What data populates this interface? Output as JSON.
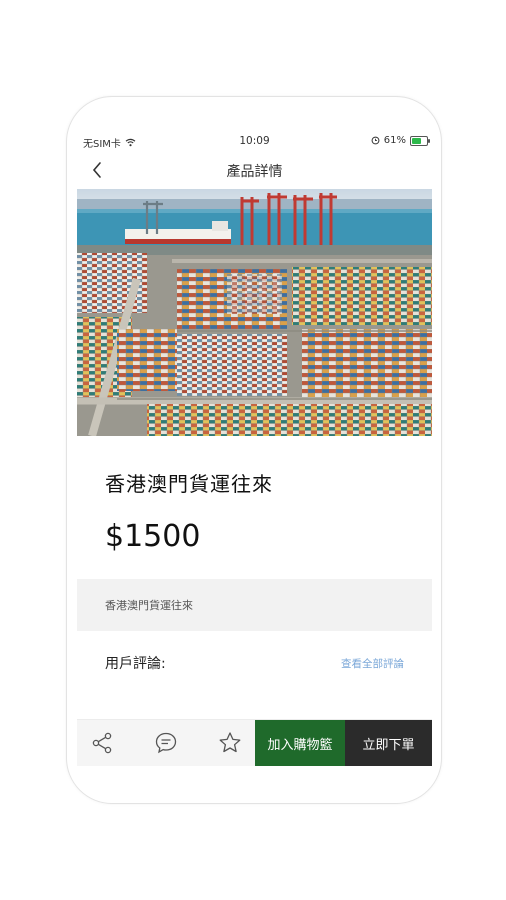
{
  "status_bar": {
    "carrier": "无SIM卡",
    "time": "10:09",
    "battery": "61%",
    "battery_level": 0.61,
    "icons": [
      "wifi-icon",
      "alarm-icon",
      "battery-icon"
    ]
  },
  "nav": {
    "title": "產品詳情",
    "back_icon": "chevron-left-icon"
  },
  "product": {
    "image": "container-port-photo",
    "title": "香港澳門貨運往來",
    "price": "$1500",
    "description": "香港澳門貨運往來"
  },
  "reviews": {
    "label": "用戶評論:",
    "view_all": "查看全部評論"
  },
  "bottom_bar": {
    "icons": [
      "share-icon",
      "comment-icon",
      "star-icon"
    ],
    "add_to_cart": "加入購物籃",
    "buy_now": "立即下單"
  },
  "colors": {
    "cart_button": "#1f6a2b",
    "buy_button": "#2b2b2b",
    "link": "#7aa7d8",
    "desc_bg": "#f2f2f2"
  }
}
